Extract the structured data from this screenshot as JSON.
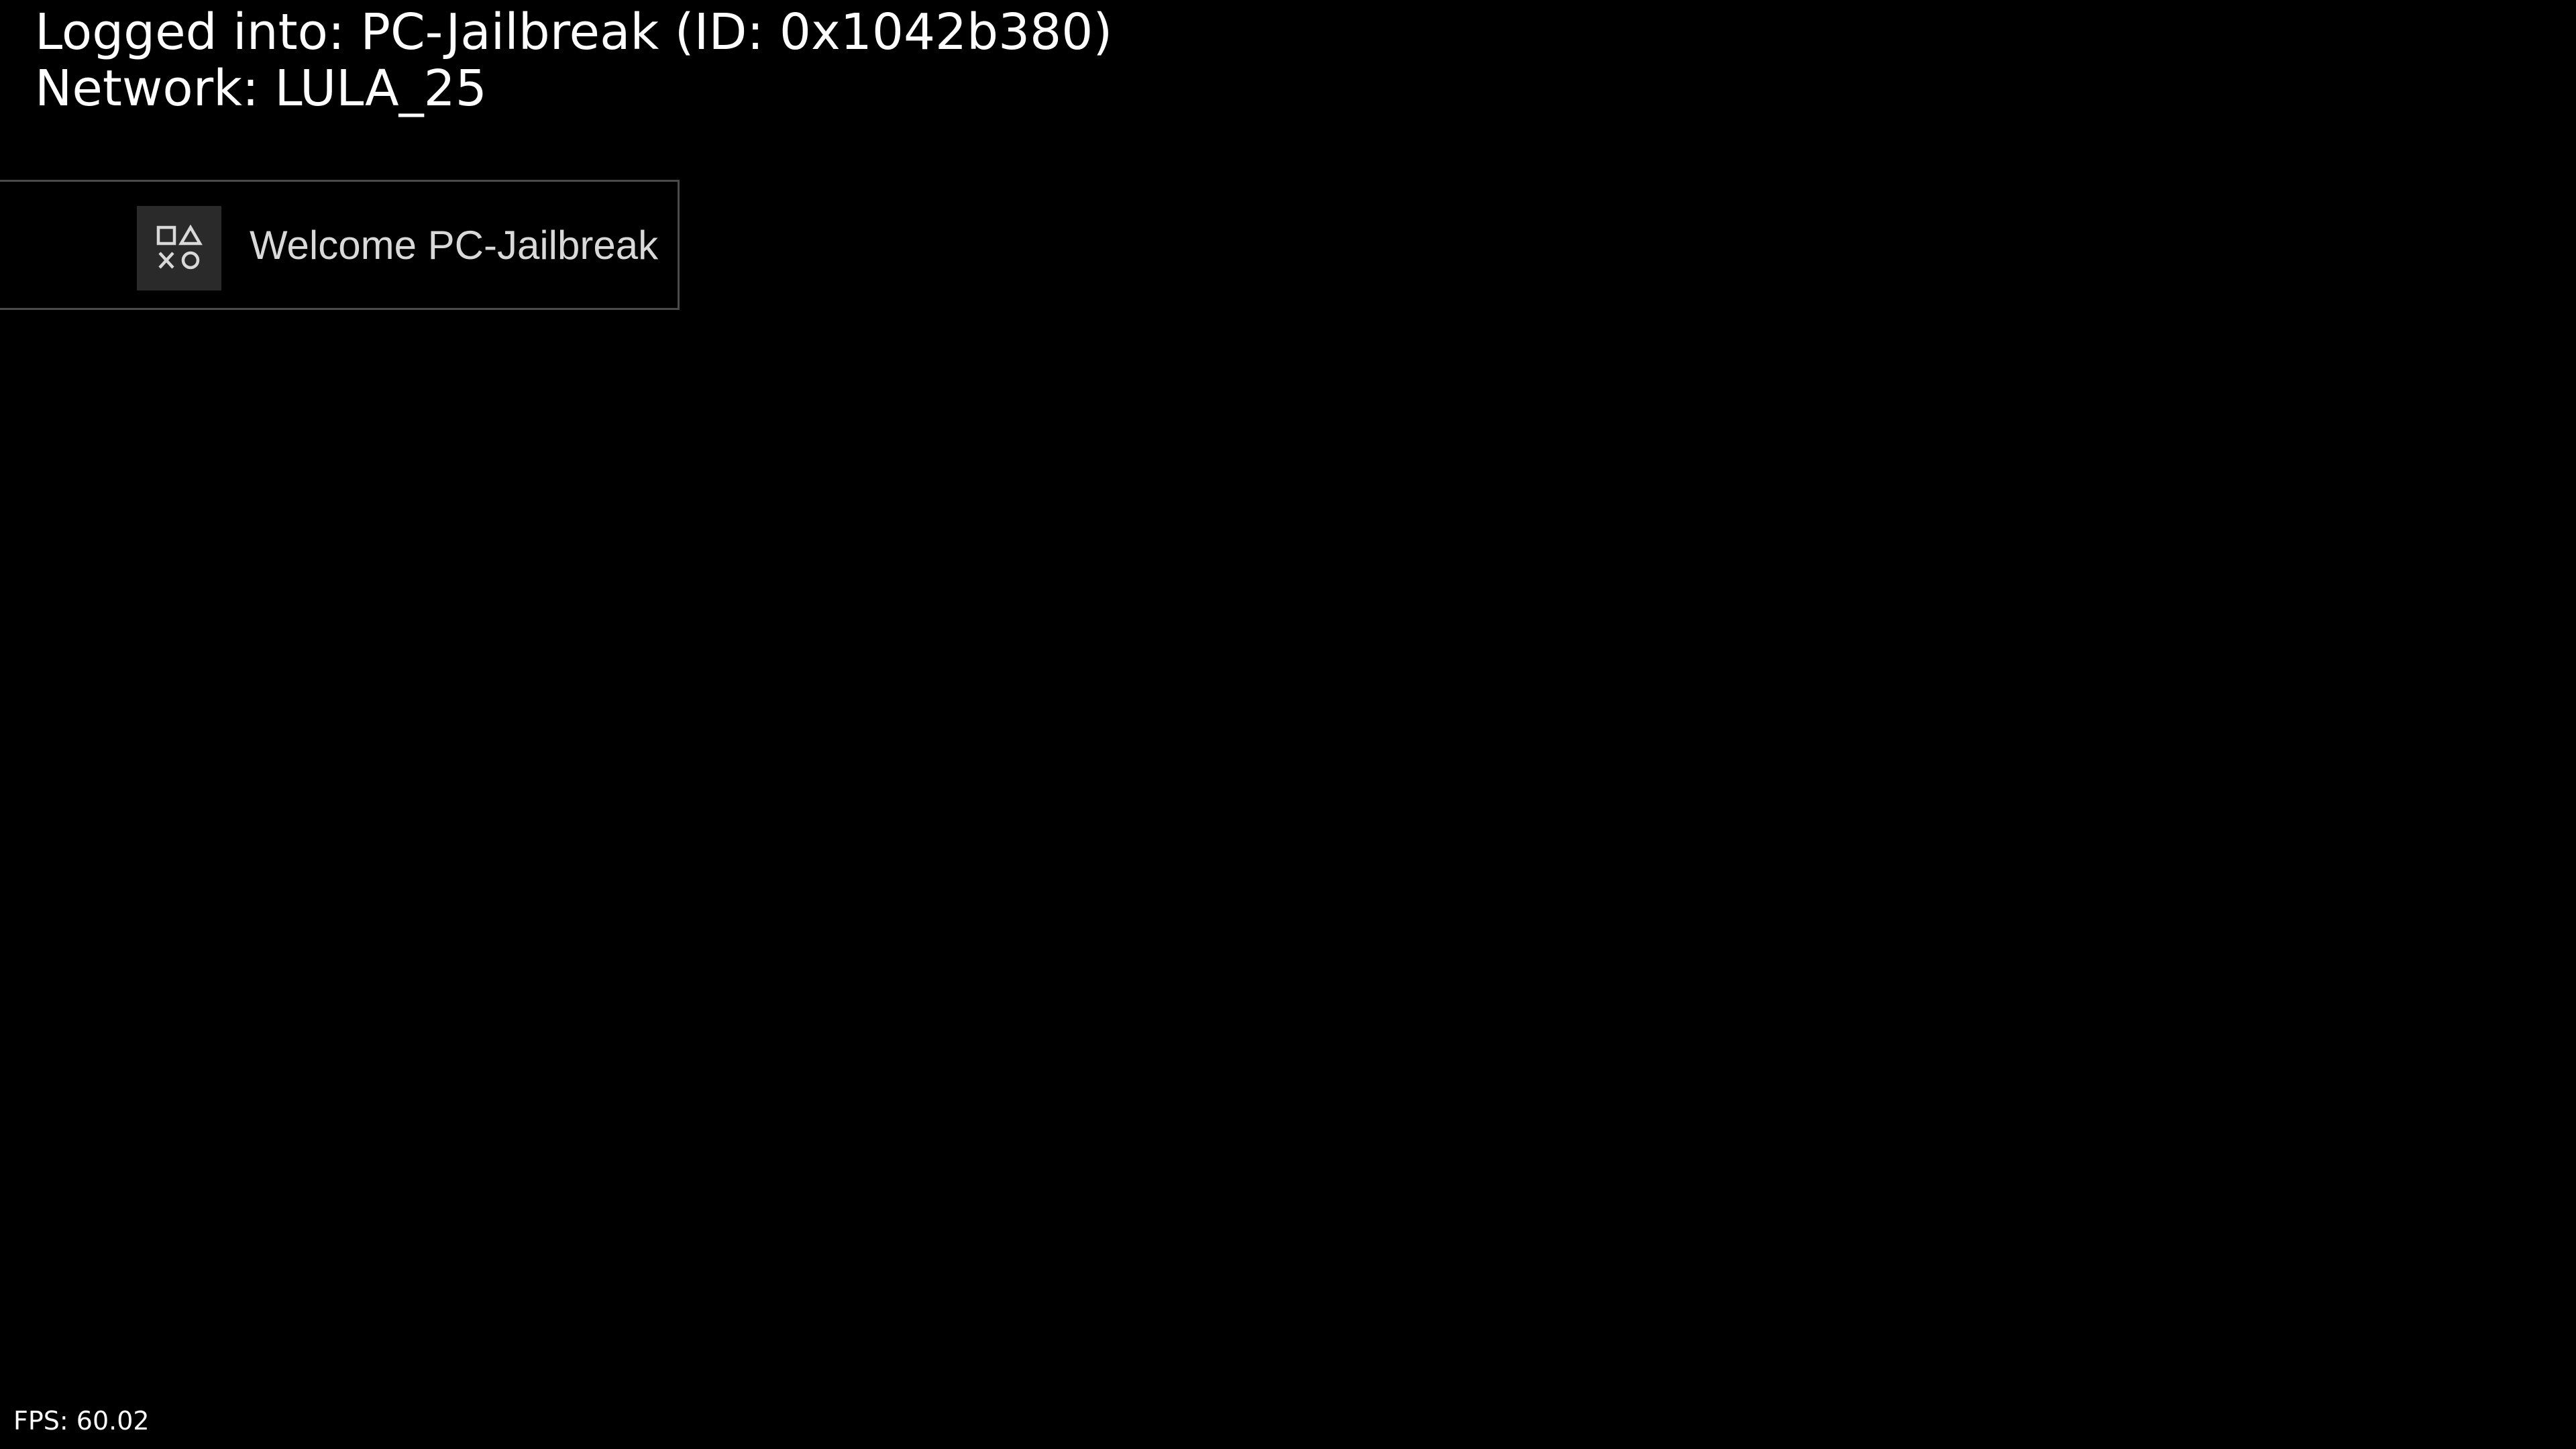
{
  "status": {
    "logged_in": "Logged into: PC-Jailbreak (ID: 0x1042b380)",
    "network": "Network: LULA_25"
  },
  "notification": {
    "icon": "playstation-shapes-icon",
    "message": "Welcome PC-Jailbreak"
  },
  "fps": "FPS: 60.02",
  "colors": {
    "background": "#000000",
    "text": "#ffffff",
    "notification_border": "#4a4a4a",
    "icon_background": "#2a2a2a"
  }
}
